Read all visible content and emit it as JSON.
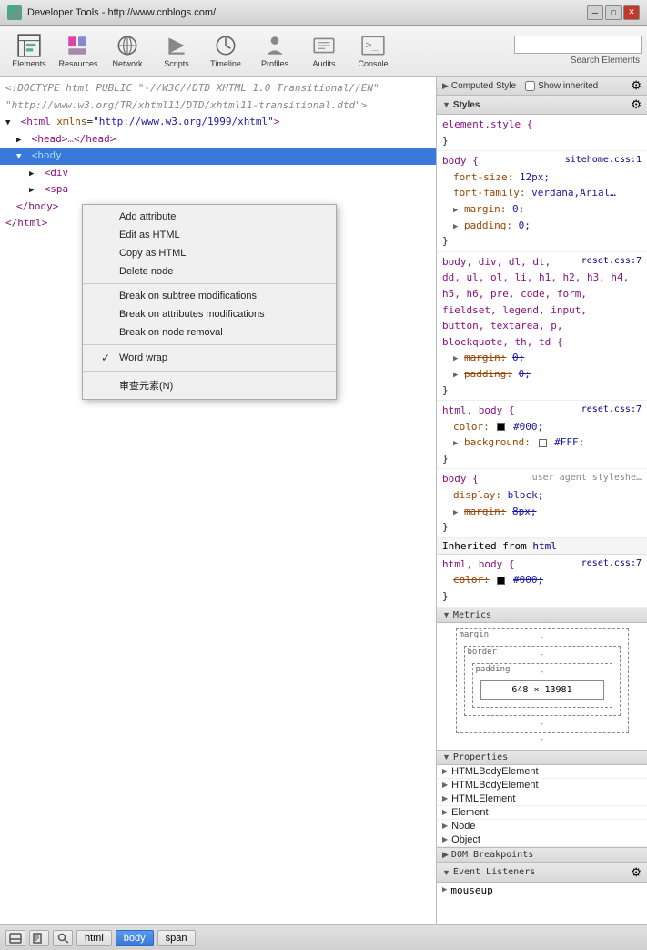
{
  "titlebar": {
    "title": "Developer Tools - http://www.cnblogs.com/",
    "icon": "⚙"
  },
  "toolbar": {
    "buttons": [
      {
        "id": "elements",
        "label": "Elements"
      },
      {
        "id": "resources",
        "label": "Resources"
      },
      {
        "id": "network",
        "label": "Network"
      },
      {
        "id": "scripts",
        "label": "Scripts"
      },
      {
        "id": "timeline",
        "label": "Timeline"
      },
      {
        "id": "profiles",
        "label": "Profiles"
      },
      {
        "id": "audits",
        "label": "Audits"
      },
      {
        "id": "console",
        "label": "Console"
      }
    ],
    "search_placeholder": "",
    "search_label": "Search Elements"
  },
  "dom_tree": {
    "lines": [
      {
        "id": "doctype",
        "indent": 0,
        "html": "<!DOCTYPE html PUBLIC \"-//W3C//DTD XHTML 1.0 Transitional//EN\"",
        "selected": false
      },
      {
        "id": "dtd",
        "indent": 0,
        "html": "\"http://www.w3.org/TR/xhtml11/DTD/xhtml11-transitional.dtd\">",
        "selected": false
      },
      {
        "id": "html",
        "indent": 0,
        "html": "▼ <html xmlns=\"http://www.w3.org/1999/xhtml\">",
        "selected": false
      },
      {
        "id": "head",
        "indent": 1,
        "html": "▶ <head>…</head>",
        "selected": false
      },
      {
        "id": "body",
        "indent": 1,
        "html": "▼ <body",
        "selected": true
      },
      {
        "id": "div",
        "indent": 2,
        "html": "▶ <div",
        "selected": false
      },
      {
        "id": "span",
        "indent": 2,
        "html": "▶ <spa",
        "selected": false
      },
      {
        "id": "body-close",
        "indent": 1,
        "html": "</body>",
        "selected": false
      },
      {
        "id": "html-close",
        "indent": 0,
        "html": "</html>",
        "selected": false
      }
    ]
  },
  "context_menu": {
    "items": [
      {
        "id": "add-attribute",
        "label": "Add attribute",
        "type": "item"
      },
      {
        "id": "edit-html",
        "label": "Edit as HTML",
        "type": "item"
      },
      {
        "id": "copy-html",
        "label": "Copy as HTML",
        "type": "item"
      },
      {
        "id": "delete-node",
        "label": "Delete node",
        "type": "item"
      },
      {
        "id": "sep1",
        "type": "separator"
      },
      {
        "id": "break-subtree",
        "label": "Break on subtree modifications",
        "type": "item"
      },
      {
        "id": "break-attrs",
        "label": "Break on attributes modifications",
        "type": "item"
      },
      {
        "id": "break-removal",
        "label": "Break on node removal",
        "type": "item"
      },
      {
        "id": "sep2",
        "type": "separator"
      },
      {
        "id": "word-wrap",
        "label": "Word wrap",
        "type": "check",
        "checked": true
      },
      {
        "id": "sep3",
        "type": "separator"
      },
      {
        "id": "inspect",
        "label": "审查元素(N)",
        "type": "item"
      }
    ]
  },
  "right_panel": {
    "computed_style": {
      "header": "Computed Style",
      "show_inherited": "Show inherited"
    },
    "styles": {
      "header": "Styles",
      "rules": [
        {
          "selector": "element.style {",
          "source": "",
          "properties": [],
          "close": "}"
        },
        {
          "selector": "body {",
          "source": "sitehome.css:1",
          "properties": [
            {
              "name": "font-size:",
              "value": "12px;"
            },
            {
              "name": "font-family:",
              "value": "verdana,Arial…"
            },
            {
              "name": "▶ margin:",
              "value": "0;"
            },
            {
              "name": "▶ padding:",
              "value": "0;"
            }
          ],
          "close": "}"
        },
        {
          "selector": "body, div, dl, dt,",
          "source": "reset.css:7",
          "selector2": "dd, ul, ol, li, h1, h2, h3, h4,",
          "selector3": "h5, h6, pre, code, form,",
          "selector4": "fieldset, legend, input,",
          "selector5": "button, textarea, p,",
          "selector6": "blockquote, th, td {",
          "properties": [
            {
              "name": "▶ margin:",
              "value": "0;",
              "strikethrough": true
            },
            {
              "name": "▶ padding:",
              "value": "0;",
              "strikethrough": true
            }
          ],
          "close": "}"
        },
        {
          "selector": "html, body {",
          "source": "reset.css:7",
          "properties": [
            {
              "name": "color:",
              "value": "#000;",
              "color_box": "#000000"
            },
            {
              "name": "▶ background:",
              "value": "#FFF;",
              "color_box": "#FFFFFF",
              "checkbox": true
            }
          ],
          "close": "}"
        },
        {
          "selector": "body {",
          "source": "user agent styleshe…",
          "properties": [
            {
              "name": "display:",
              "value": "block;"
            },
            {
              "name": "▶ margin:",
              "value": "8px;",
              "strikethrough": true
            }
          ],
          "close": "}"
        }
      ]
    },
    "inherited": {
      "label": "Inherited from",
      "from": "html",
      "rules": [
        {
          "selector": "html, body {",
          "source": "reset.css:7",
          "properties": [
            {
              "name": "color:",
              "value": "#000;",
              "strikethrough": true,
              "color_box": "#000000"
            }
          ],
          "close": "}"
        }
      ]
    },
    "metrics": {
      "header": "Metrics",
      "margin_label": "margin",
      "border_label": "border",
      "padding_label": "padding",
      "size": "648 × 13981",
      "margin_dash": "-",
      "border_dash": "-",
      "padding_dash": "-",
      "bottom_dash": "-",
      "bottom2_dash": "-"
    },
    "properties": {
      "header": "Properties",
      "items": [
        {
          "name": "HTMLBodyElement"
        },
        {
          "name": "HTMLBodyElement"
        },
        {
          "name": "HTMLElement"
        },
        {
          "name": "Element"
        },
        {
          "name": "Node"
        },
        {
          "name": "Object"
        }
      ]
    },
    "dom_breakpoints": {
      "header": "DOM Breakpoints"
    },
    "event_listeners": {
      "header": "Event Listeners",
      "items": [
        {
          "name": "mouseup"
        }
      ]
    }
  },
  "bottom_bar": {
    "breadcrumbs": [
      {
        "label": "html",
        "selected": false
      },
      {
        "label": "body",
        "selected": true
      },
      {
        "label": "span",
        "selected": false
      }
    ]
  }
}
